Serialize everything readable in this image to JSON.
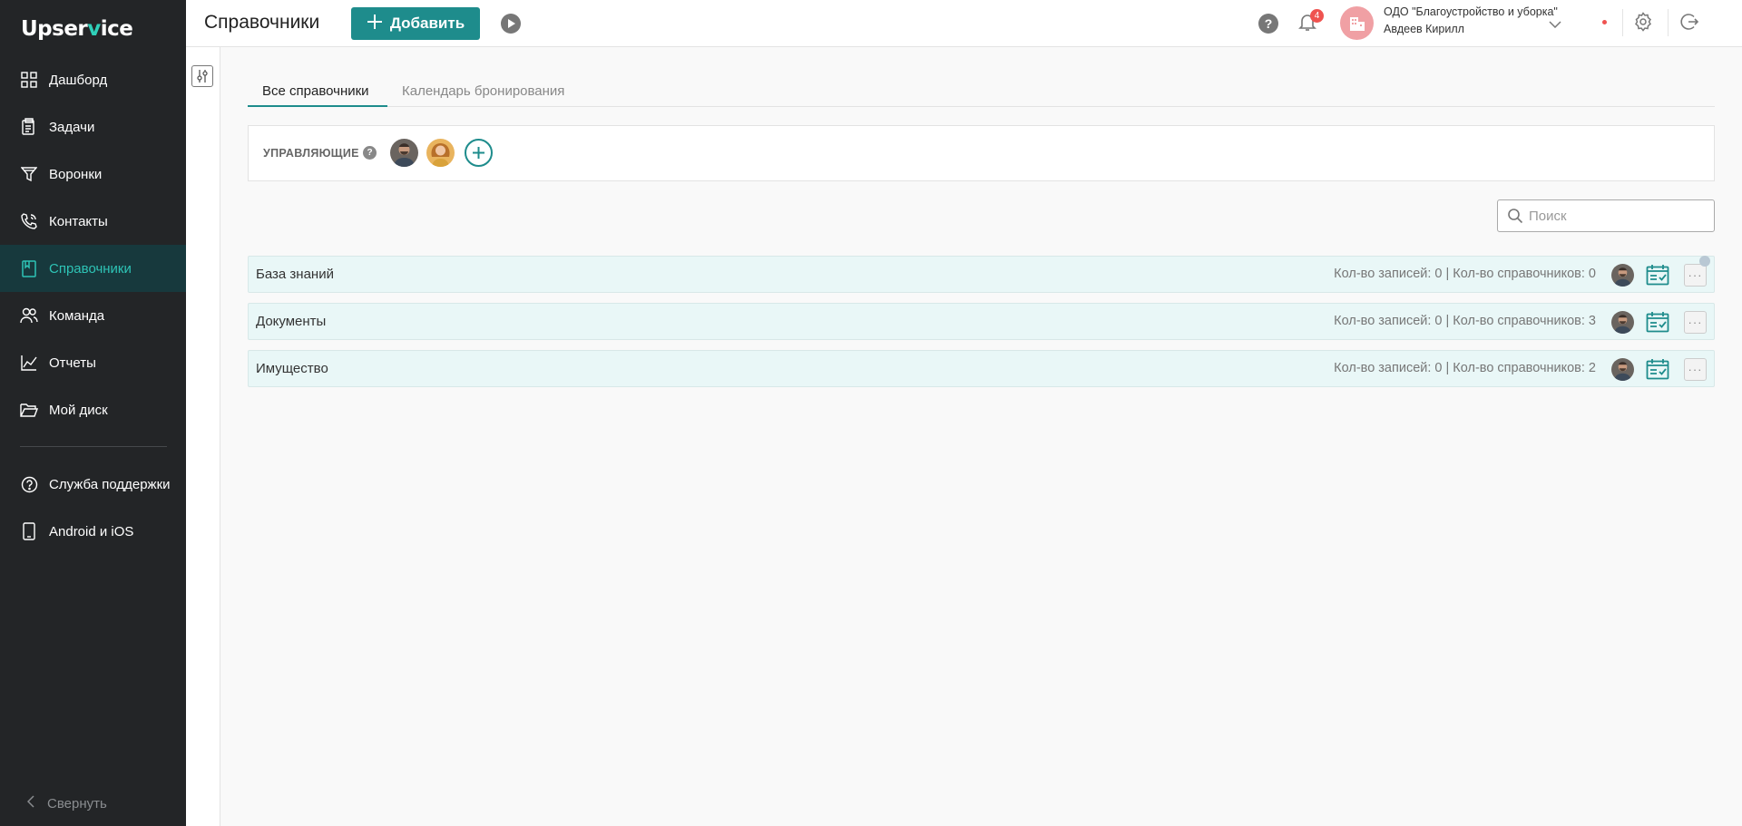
{
  "app": {
    "logo_part1": "Upser",
    "logo_v": "v",
    "logo_part2": "ice",
    "accent_color": "#1e8c8c"
  },
  "sidebar": {
    "items": [
      {
        "label": "Дашборд",
        "icon": "dashboard-icon"
      },
      {
        "label": "Задачи",
        "icon": "tasks-icon"
      },
      {
        "label": "Воронки",
        "icon": "funnel-icon"
      },
      {
        "label": "Контакты",
        "icon": "contacts-icon"
      },
      {
        "label": "Справочники",
        "icon": "book-icon",
        "active": true
      },
      {
        "label": "Команда",
        "icon": "team-icon"
      },
      {
        "label": "Отчеты",
        "icon": "reports-icon"
      },
      {
        "label": "Мой диск",
        "icon": "folder-icon"
      }
    ],
    "bottom_items": [
      {
        "label": "Служба поддержки",
        "icon": "support-icon"
      },
      {
        "label": "Android и iOS",
        "icon": "mobile-icon"
      }
    ],
    "collapse_label": "Свернуть"
  },
  "header": {
    "title": "Справочники",
    "add_label": "Добавить",
    "notification_count": "4",
    "org_name": "ОДО \"Благоустройство и уборка\"",
    "user_name": "Авдеев Кирилл"
  },
  "tabs": [
    {
      "label": "Все справочники",
      "active": true
    },
    {
      "label": "Календарь бронирования",
      "active": false
    }
  ],
  "managers": {
    "label": "УПРАВЛЯЮЩИЕ",
    "help": "?"
  },
  "search": {
    "placeholder": "Поиск",
    "value": ""
  },
  "directories": [
    {
      "name": "База знаний",
      "stats": "Кол-во записей: 0 | Кол-во справочников: 0"
    },
    {
      "name": "Документы",
      "stats": "Кол-во записей: 0 | Кол-во справочников: 3"
    },
    {
      "name": "Имущество",
      "stats": "Кол-во записей: 0 | Кол-во справочников: 2"
    }
  ]
}
